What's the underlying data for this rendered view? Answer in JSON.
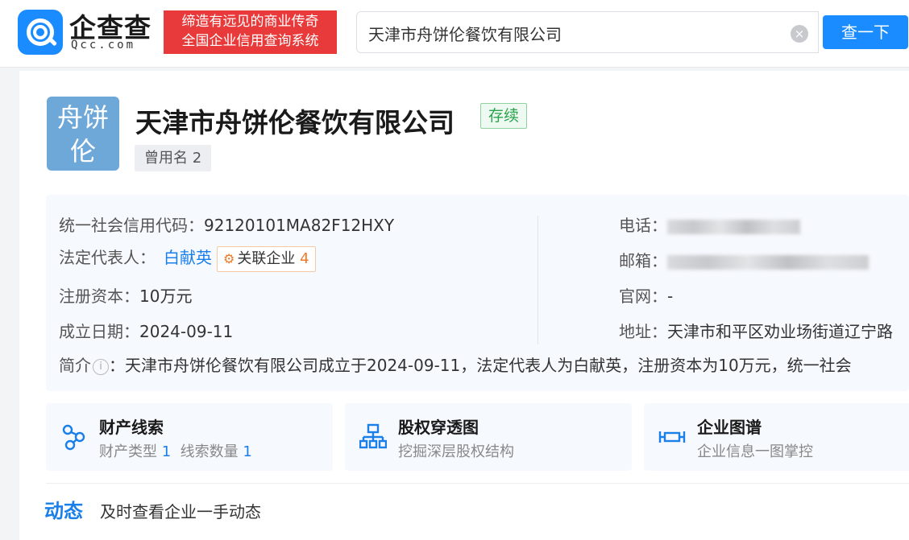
{
  "header": {
    "logo_text": "企查查",
    "logo_sub": "Qcc.com",
    "slogan_line1": "缔造有远见的商业传奇",
    "slogan_line2": "全国企业信用查询系统",
    "search_value": "天津市舟饼伦餐饮有限公司",
    "clear_icon": "×",
    "search_button": "查一下"
  },
  "company": {
    "avatar_line1": "舟饼",
    "avatar_line2": "伦",
    "name": "天津市舟饼伦餐饮有限公司",
    "status": "存续",
    "alias": "曾用名 2"
  },
  "info": {
    "credit_code_label": "统一社会信用代码：",
    "credit_code": "92120101MA82F12HXY",
    "legal_rep_label": "法定代表人：",
    "legal_rep": "白献英",
    "assoc_label": "关联企业",
    "assoc_count": "4",
    "capital_label": "注册资本：",
    "capital": "10万元",
    "founded_label": "成立日期：",
    "founded": "2024-09-11",
    "phone_label": "电话：",
    "email_label": "邮箱：",
    "website_label": "官网：",
    "website": "-",
    "address_label": "地址：",
    "address": "天津市和平区劝业场街道辽宁路",
    "intro_label": "简介",
    "intro_text": "：天津市舟饼伦餐饮有限公司成立于2024-09-11，法定代表人为白献英，注册资本为10万元，统一社会"
  },
  "features": [
    {
      "title": "财产线索",
      "sub_a": "财产类型",
      "num_a": "1",
      "sub_b": "线索数量",
      "num_b": "1"
    },
    {
      "title": "股权穿透图",
      "sub": "挖掘深层股权结构"
    },
    {
      "title": "企业图谱",
      "sub": "企业信息一图掌控"
    }
  ],
  "dynamics": {
    "title": "动态",
    "subtitle": "及时查看企业一手动态"
  },
  "colors": {
    "brand_blue": "#1a8cff",
    "slogan_red": "#e83a3a",
    "status_green": "#2ba24c",
    "avatar_blue": "#6ea8d8"
  }
}
